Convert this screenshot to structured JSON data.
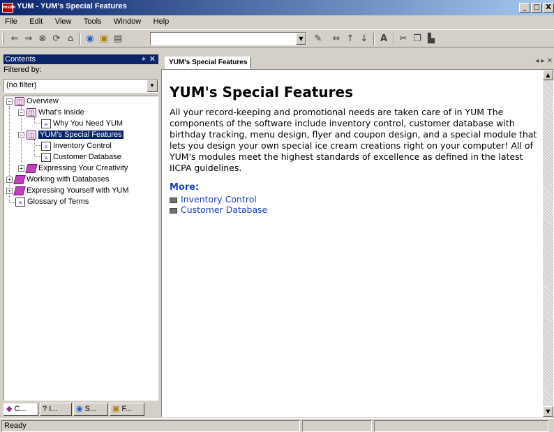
{
  "window": {
    "title": "YUM - YUM's Special Features",
    "app_icon": "msdn",
    "buttons": [
      "_",
      "□",
      "X"
    ]
  },
  "menu": [
    "File",
    "Edit",
    "View",
    "Tools",
    "Window",
    "Help"
  ],
  "toolbar": {
    "icons": [
      "back-icon",
      "forward-icon",
      "stop-icon",
      "refresh-icon",
      "home-icon",
      "search-icon",
      "favorites-icon",
      "sync-contents-icon",
      "new-icon",
      "resize-icon",
      "up-icon",
      "down-icon",
      "font-size-icon",
      "cut-icon",
      "copy-icon",
      "paste-icon"
    ],
    "url_value": ""
  },
  "contents_pane": {
    "title": "Contents",
    "filter_label": "Filtered by:",
    "filter_value": "(no filter)",
    "tree": [
      {
        "label": "Overview",
        "level": 0,
        "icon": "open-book",
        "expander": "−"
      },
      {
        "label": "What's Inside",
        "level": 1,
        "icon": "open-book",
        "expander": "−"
      },
      {
        "label": "Why You Need YUM",
        "level": 2,
        "icon": "page",
        "expander": ""
      },
      {
        "label": "YUM's Special Features",
        "level": 1,
        "icon": "open-book",
        "expander": "−",
        "selected": true
      },
      {
        "label": "Inventory Control",
        "level": 2,
        "icon": "page",
        "expander": ""
      },
      {
        "label": "Customer Database",
        "level": 2,
        "icon": "page",
        "expander": ""
      },
      {
        "label": "Expressing Your Creativity",
        "level": 1,
        "icon": "closed-book",
        "expander": "+"
      },
      {
        "label": "Working with Databases",
        "level": 0,
        "icon": "closed-book",
        "expander": "+"
      },
      {
        "label": "Expressing Yourself with YUM",
        "level": 0,
        "icon": "closed-book",
        "expander": "+"
      },
      {
        "label": "Glossary of Terms",
        "level": 0,
        "icon": "page",
        "expander": ""
      }
    ],
    "tabs": [
      "C...",
      "I...",
      "S...",
      "F..."
    ]
  },
  "document": {
    "tab_label": "YUM's Special Features",
    "heading": "YUM's Special Features",
    "body": "All your record-keeping and promotional needs are taken care of in YUM The components of the software include inventory control, customer database with birthday tracking, menu design, flyer and coupon design, and a special module that lets you design your own special ice cream creations right on your computer! All of YUM's modules meet the highest standards of excellence as defined in the latest IICPA guidelines.",
    "more_label": "More:",
    "links": [
      "Inventory Control",
      "Customer Database"
    ]
  },
  "status": {
    "text": "Ready"
  }
}
